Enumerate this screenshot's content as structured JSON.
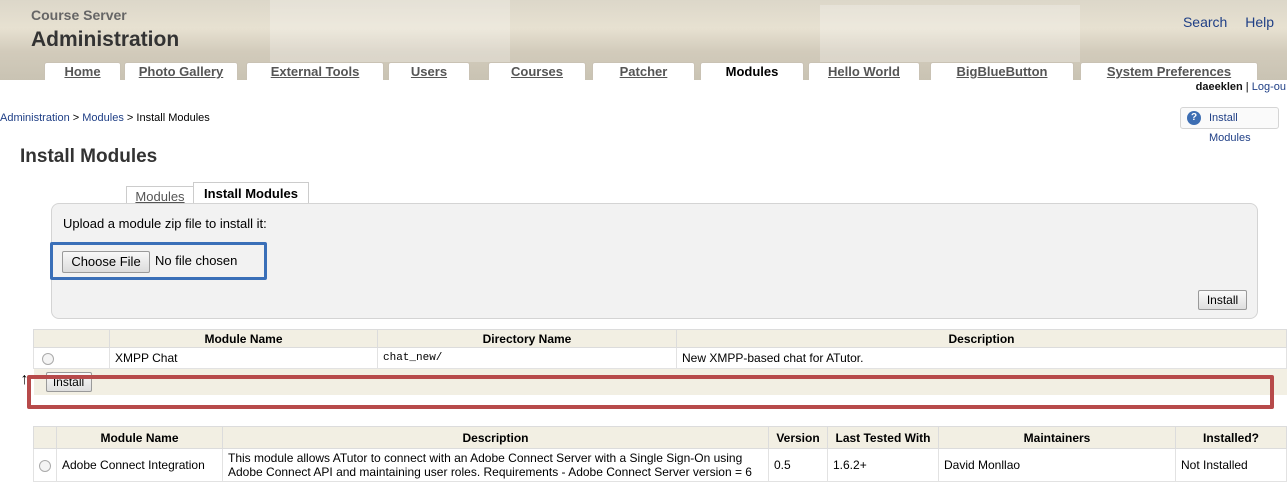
{
  "header": {
    "site_name": "Course Server",
    "section_title": "Administration",
    "top_links": [
      "Search",
      "Help"
    ],
    "tabs": [
      {
        "label": "Home",
        "active": false
      },
      {
        "label": "Photo Gallery",
        "active": false
      },
      {
        "label": "External Tools",
        "active": false
      },
      {
        "label": "Users",
        "active": false
      },
      {
        "label": "Courses",
        "active": false
      },
      {
        "label": "Patcher",
        "active": false
      },
      {
        "label": "Modules",
        "active": true
      },
      {
        "label": "Hello World",
        "active": false
      },
      {
        "label": "BigBlueButton",
        "active": false
      },
      {
        "label": "System Preferences",
        "active": false
      }
    ],
    "username": "daeeklen",
    "logout": "Log-ou"
  },
  "breadcrumb": {
    "items": [
      "Administration",
      "Modules",
      "Install Modules"
    ],
    "separator": ">"
  },
  "help_button": "Install Modules",
  "page_title": "Install Modules",
  "subtabs": {
    "modules": "Modules",
    "install": "Install Modules"
  },
  "upload": {
    "message": "Upload a module zip file to install it:",
    "choose_file": "Choose File",
    "no_file": "No file chosen",
    "install": "Install"
  },
  "modules_table": {
    "headers": [
      "Module Name",
      "Directory Name",
      "Description"
    ],
    "rows": [
      {
        "name": "XMPP Chat",
        "directory": "chat_new/",
        "description": "New XMPP-based chat for ATutor."
      }
    ],
    "install": "Install"
  },
  "available_table": {
    "headers": [
      "Module Name",
      "Description",
      "Version",
      "Last Tested With",
      "Maintainers",
      "Installed?"
    ],
    "rows": [
      {
        "name": "Adobe Connect Integration",
        "description": "This module allows ATutor to connect with an Adobe Connect Server with a Single Sign-On using Adobe Connect API and maintaining user roles. Requirements - Adobe Connect Server version = 6",
        "version": "0.5",
        "tested": "1.6.2+",
        "maintainers": "David Monllao",
        "installed": "Not Installed"
      }
    ]
  },
  "colors": {
    "highlight_blue": "#3a6fb8",
    "highlight_red": "#b74a4a",
    "link": "#1f3f86"
  }
}
